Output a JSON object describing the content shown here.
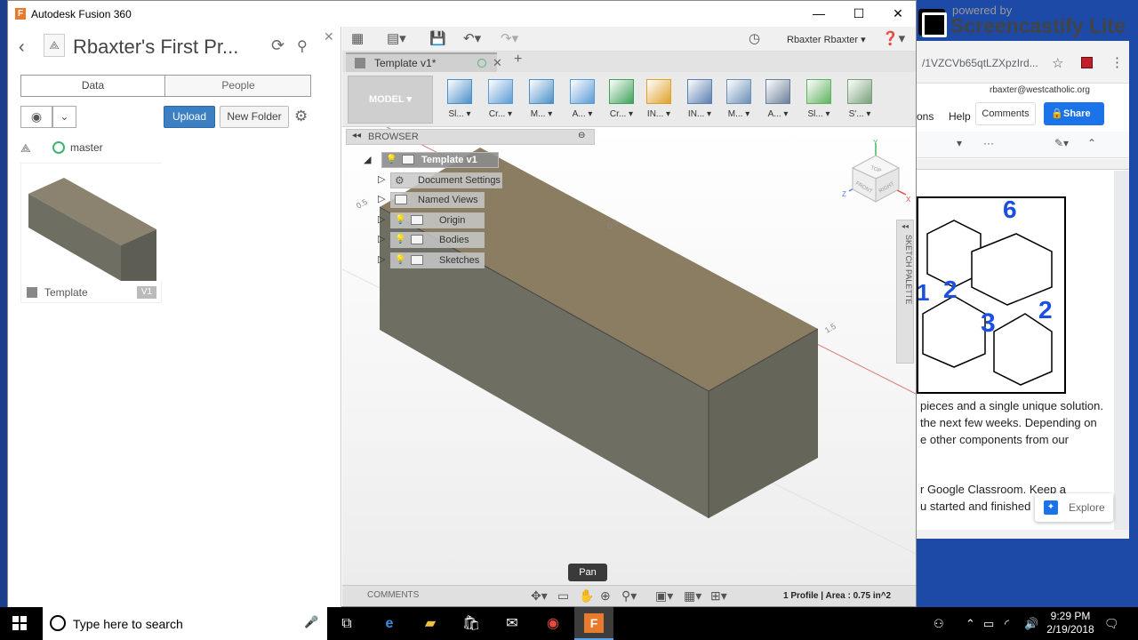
{
  "browser_bg": {
    "url": "/1VZCVb65qtLZXpzIrd...",
    "email": "rbaxter@westcatholic.org",
    "menu_ons": "ons",
    "menu_help": "Help",
    "comments": "Comments",
    "share": "Share",
    "doc_lines": [
      "pieces and a single unique solution.",
      "the next few weeks. Depending on",
      "e other components from our",
      "r Google Classroom. Keep a",
      "u started and finished"
    ],
    "explore": "Explore",
    "puzzle_numbers": [
      "6",
      "2",
      "1",
      "2",
      "3",
      "2"
    ]
  },
  "watermark": {
    "small": "powered by",
    "big": "Screencastify Lite"
  },
  "window": {
    "title": "Autodesk Fusion 360"
  },
  "data_panel": {
    "project_title": "Rbaxter's First Pr...",
    "tabs": [
      "Data",
      "People"
    ],
    "upload": "Upload",
    "new_folder": "New Folder",
    "branch": "master",
    "item_name": "Template",
    "item_version": "V1"
  },
  "app_toolbar": {
    "user": "Rbaxter Rbaxter",
    "help": "?"
  },
  "doc_tab": {
    "name": "Template v1*"
  },
  "ribbon": {
    "workspace": "MODEL",
    "groups": [
      "Sl...",
      "Cr...",
      "M...",
      "A...",
      "Cr...",
      "IN...",
      "IN...",
      "M...",
      "A...",
      "Sl...",
      "S'..."
    ]
  },
  "browser_tree": {
    "header": "BROWSER",
    "root": "Template v1",
    "nodes": [
      "Document Settings",
      "Named Views",
      "Origin",
      "Bodies",
      "Sketches"
    ]
  },
  "viewport": {
    "viewcube_faces": [
      "TOP",
      "FRONT",
      "RIGHT"
    ],
    "axis_labels": [
      "Y",
      "Z",
      "X"
    ],
    "grid_labels": [
      "0.5",
      "0.5",
      "1.5"
    ],
    "sketch_palette": "SKETCH PALETTE",
    "tooltip": "Pan"
  },
  "bottom": {
    "comments": "COMMENTS",
    "status_prefix": "1 Profile |",
    "status_area": "Area : 0.75 in^2"
  },
  "taskbar": {
    "search_placeholder": "Type here to search",
    "time": "9:29 PM",
    "date": "2/19/2018"
  },
  "colors": {
    "box_top": "#8b7d62",
    "box_front": "#6f6e62",
    "box_side": "#66655a",
    "upload_blue": "#3c7fc3",
    "share_blue": "#1a73e8",
    "taskbar": "#000000"
  }
}
